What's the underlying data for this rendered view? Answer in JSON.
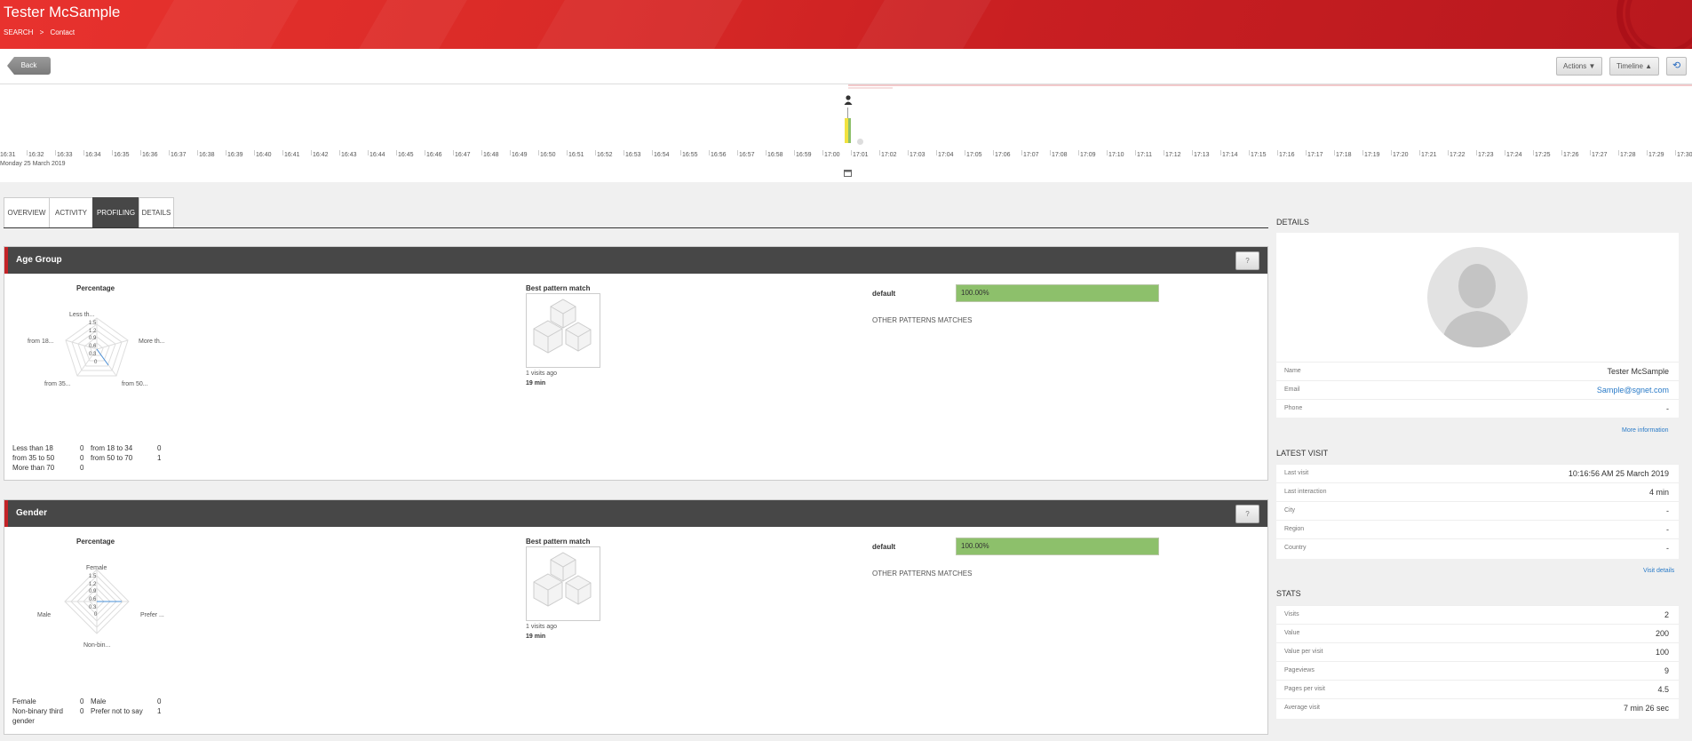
{
  "header": {
    "title": "Tester McSample",
    "crumb_search": "SEARCH",
    "crumb_sep": ">",
    "crumb_contact": "Contact"
  },
  "toolbar": {
    "back": "Back",
    "actions": "Actions ▼",
    "timeline": "Timeline ▲",
    "refresh": "⟲"
  },
  "timeline": {
    "ticks": [
      "16:31",
      "16:32",
      "16:33",
      "16:34",
      "16:35",
      "16:36",
      "16:37",
      "16:38",
      "16:39",
      "16:40",
      "16:41",
      "16:42",
      "16:43",
      "16:44",
      "16:45",
      "16:46",
      "16:47",
      "16:48",
      "16:49",
      "16:50",
      "16:51",
      "16:52",
      "16:53",
      "16:54",
      "16:55",
      "16:56",
      "16:57",
      "16:58",
      "16:59",
      "17:00",
      "17:01",
      "17:02",
      "17:03",
      "17:04",
      "17:05",
      "17:06",
      "17:07",
      "17:08",
      "17:09",
      "17:10",
      "17:11",
      "17:12",
      "17:13",
      "17:14",
      "17:15",
      "17:16",
      "17:17",
      "17:18",
      "17:19",
      "17:20",
      "17:21",
      "17:22",
      "17:23",
      "17:24",
      "17:25",
      "17:26",
      "17:27",
      "17:28",
      "17:29",
      "17:30"
    ],
    "date": "Monday 25 March 2019"
  },
  "tabs": [
    "OVERVIEW",
    "ACTIVITY",
    "PROFILING",
    "DETAILS"
  ],
  "age": {
    "title": "Age Group",
    "help": "?",
    "percentage": "Percentage",
    "radar_labels": [
      "Less th...",
      "More th...",
      "from 50...",
      "from 35...",
      "from 18..."
    ],
    "radar_ticks": [
      "1.5",
      "1.2",
      "0.9",
      "0.6",
      "0.3",
      "0"
    ],
    "values": {
      "less18_l": "Less than 18",
      "less18_v": "0",
      "f18_l": "from 18 to 34",
      "f18_v": "0",
      "f35_l": "from 35 to 50",
      "f35_v": "0",
      "f50_l": "from 50 to 70",
      "f50_v": "1",
      "m70_l": "More than 70",
      "m70_v": "0"
    },
    "best": "Best pattern match",
    "visits": "1 visits ago",
    "duration": "19 min",
    "default": "default",
    "pct": "100.00%",
    "other": "OTHER PATTERNS MATCHES"
  },
  "gender": {
    "title": "Gender",
    "help": "?",
    "percentage": "Percentage",
    "radar_labels": [
      "Female",
      "Prefer ...",
      "Non-bin...",
      "Male"
    ],
    "radar_ticks": [
      "1.5",
      "1.2",
      "0.9",
      "0.6",
      "0.3",
      "0"
    ],
    "values": {
      "female_l": "Female",
      "female_v": "0",
      "male_l": "Male",
      "male_v": "0",
      "nb_l1": "Non-binary third",
      "nb_l2": "gender",
      "nb_v": "0",
      "pref_l": "Prefer not to say",
      "pref_v": "1"
    },
    "best": "Best pattern match",
    "visits": "1 visits ago",
    "duration": "19 min",
    "default": "default",
    "pct": "100.00%",
    "other": "OTHER PATTERNS MATCHES"
  },
  "details": {
    "title": "DETAILS",
    "name_k": "Name",
    "name_v": "Tester McSample",
    "email_k": "Email",
    "email_v": "Sample@sgnet.com",
    "phone_k": "Phone",
    "phone_v": "-",
    "more": "More information"
  },
  "latest": {
    "title": "LATEST VISIT",
    "last_k": "Last visit",
    "last_v": "10:16:56 AM 25 March 2019",
    "inter_k": "Last interaction",
    "inter_v": "4 min",
    "city_k": "City",
    "city_v": "-",
    "region_k": "Region",
    "region_v": "-",
    "country_k": "Country",
    "country_v": "-",
    "link": "Visit details"
  },
  "stats": {
    "title": "STATS",
    "visits_k": "Visits",
    "visits_v": "2",
    "value_k": "Value",
    "value_v": "200",
    "vpv_k": "Value per visit",
    "vpv_v": "100",
    "pv_k": "Pageviews",
    "pv_v": "9",
    "ppv_k": "Pages per visit",
    "ppv_v": "4.5",
    "avg_k": "Average visit",
    "avg_v": "7 min 26 sec"
  },
  "colors": {
    "accent": "#c32226",
    "bar": "#8dc06b",
    "link": "#2a7bc8"
  }
}
